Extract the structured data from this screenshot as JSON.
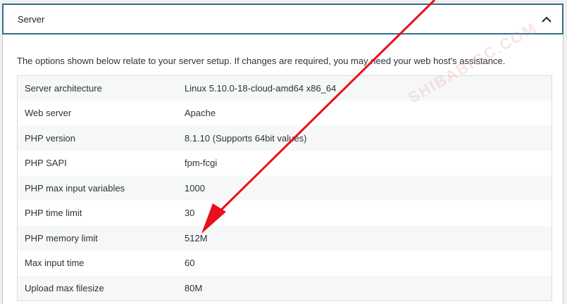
{
  "section": {
    "title": "Server",
    "toggle_icon": "chevron-up-icon"
  },
  "description": "The options shown below relate to your server setup. If changes are required, you may need your web host's assistance.",
  "rows": [
    {
      "label": "Server architecture",
      "value": "Linux 5.10.0-18-cloud-amd64 x86_64"
    },
    {
      "label": "Web server",
      "value": "Apache"
    },
    {
      "label": "PHP version",
      "value": "8.1.10 (Supports 64bit values)"
    },
    {
      "label": "PHP SAPI",
      "value": "fpm-fcgi"
    },
    {
      "label": "PHP max input variables",
      "value": "1000"
    },
    {
      "label": "PHP time limit",
      "value": "30"
    },
    {
      "label": "PHP memory limit",
      "value": "512M"
    },
    {
      "label": "Max input time",
      "value": "60"
    },
    {
      "label": "Upload max filesize",
      "value": "80M"
    }
  ],
  "watermark": "SHIBABIGC.COM",
  "colors": {
    "header_border": "#2f6f8f",
    "arrow": "#e8101a",
    "row_alt": "#f6f7f7"
  }
}
